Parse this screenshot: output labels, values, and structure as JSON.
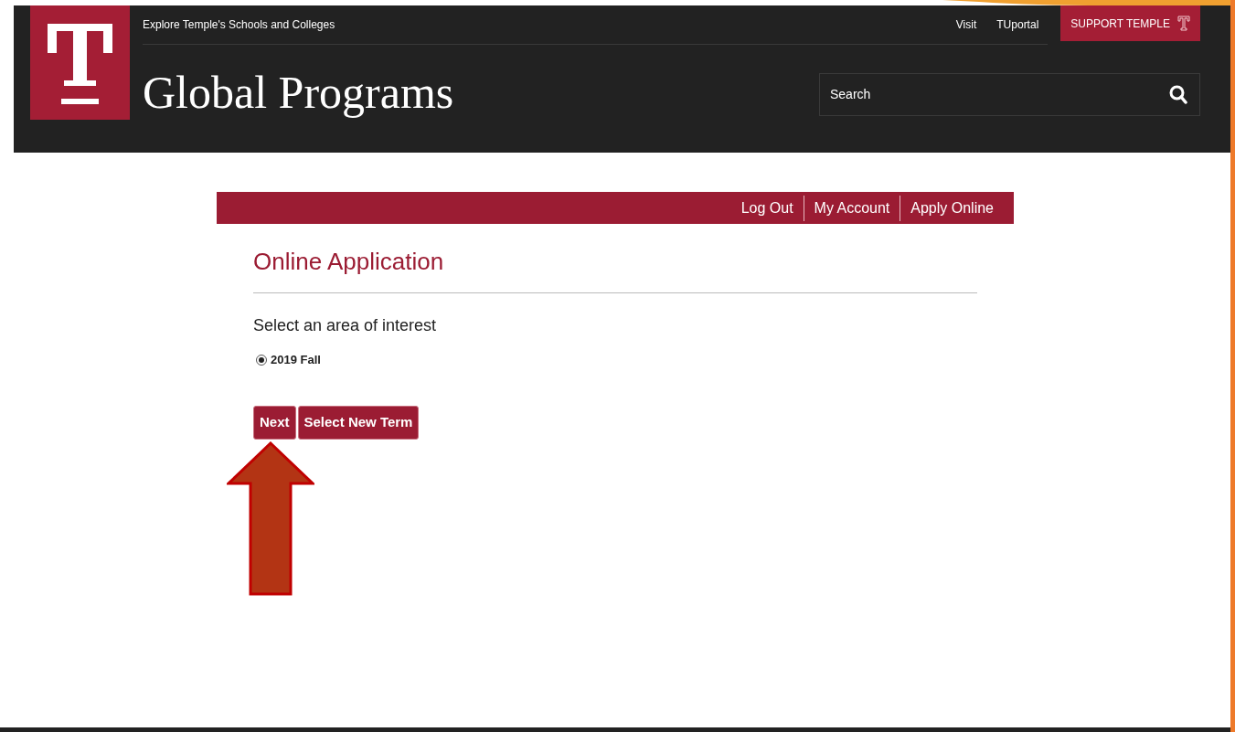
{
  "header": {
    "explore_link": "Explore Temple's Schools and Colleges",
    "utility_links": [
      "Visit",
      "TUportal"
    ],
    "support_button": "SUPPORT TEMPLE",
    "site_title": "Global Programs",
    "search": {
      "placeholder": "Search"
    }
  },
  "account_nav": [
    "Log Out",
    "My Account",
    "Apply Online"
  ],
  "page_title": "Online Application",
  "prompt": "Select an area of interest",
  "options": [
    {
      "label": "2019 Fall",
      "selected": true
    }
  ],
  "buttons": [
    "Next",
    "Select New Term"
  ]
}
